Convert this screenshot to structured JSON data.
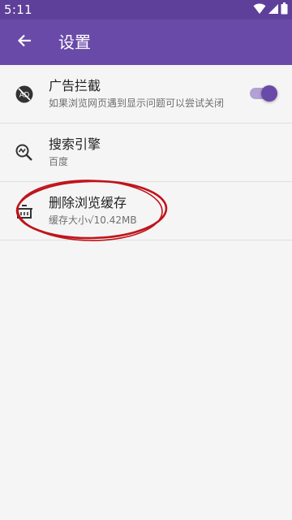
{
  "status_bar": {
    "time": "5:11",
    "icons": [
      "wifi-icon",
      "signal-icon",
      "battery-icon"
    ]
  },
  "app_bar": {
    "back_icon": "arrow-left-icon",
    "title": "设置"
  },
  "settings": [
    {
      "id": "ad-block",
      "icon": "ad-block-icon",
      "title": "广告拦截",
      "subtitle": "如果浏览网页遇到显示问题可以尝试关闭",
      "toggle_on": true
    },
    {
      "id": "search-engine",
      "icon": "search-engine-icon",
      "title": "搜索引擎",
      "subtitle": "百度"
    },
    {
      "id": "clear-cache",
      "icon": "clear-cache-icon",
      "title": "删除浏览缓存",
      "subtitle": "缓存大小√10.42MB"
    }
  ],
  "colors": {
    "status_bar": "#5e3f9a",
    "app_bar": "#6a4aa8",
    "accent": "#6a4aa8",
    "toggle_track": "#b3a0d4",
    "annotation": "#c0141b",
    "background": "#f5f5f5"
  }
}
